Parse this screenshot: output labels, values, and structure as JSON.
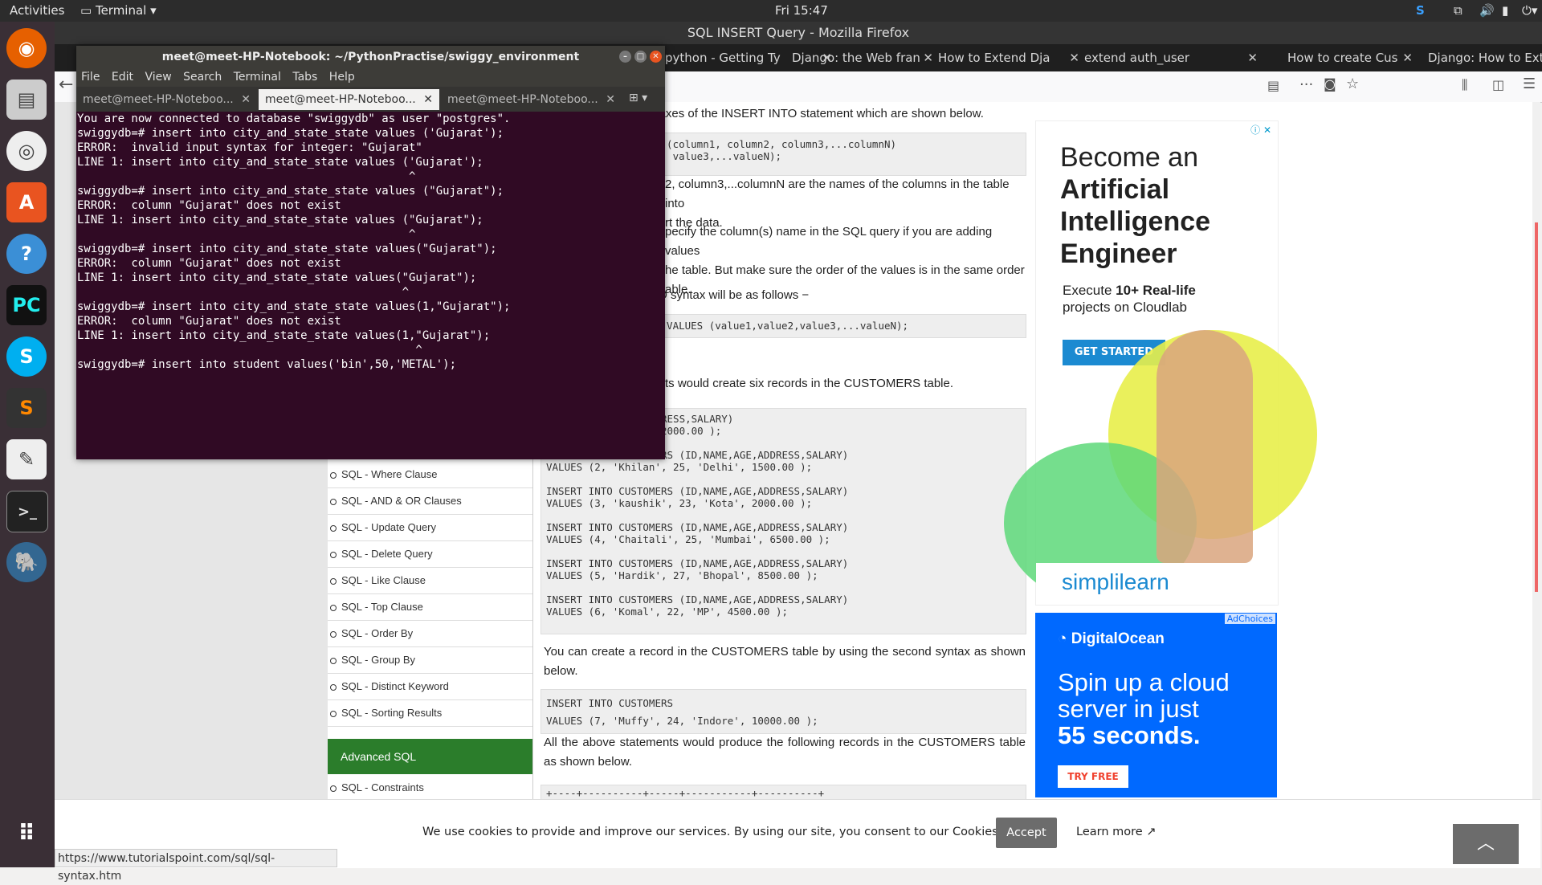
{
  "topbar": {
    "activities": "Activities",
    "app": "Terminal",
    "clock": "Fri 15:47"
  },
  "firefox": {
    "title": "SQL INSERT Query - Mozilla Firefox",
    "tabs": [
      "python - Getting Ty",
      "Django: the Web fran",
      "How to Extend Dja",
      "extend auth_user",
      "How to create Cus",
      "Django: How to Exten"
    ]
  },
  "page": {
    "p1": "ntaxes of the INSERT INTO statement which are shown below.",
    "code1": "E (column1, column2, column3,...columnN)\n2, value3,...valueN);",
    "p2a": "2, column3,...columnN are the names of the columns in the table into",
    "p2b": "rt the data.",
    "p3a": "pecify the column(s) name in the SQL query if you are adding values",
    "p3b": "he table. But make sure the order of the values is in the same order",
    "p3c": "able.",
    "p4": "D syntax will be as follows −",
    "code2": "E VALUES (value1,value2,value3,...valueN);",
    "p5": "ts would create six records in the CUSTOMERS table.",
    "code3": "RS (ID,NAME,AGE,ADDRESS,SALARY)\n, 32, 'Ahmedabad', 2000.00 );\n\nINSERT INTO CUSTOMERS (ID,NAME,AGE,ADDRESS,SALARY)\nVALUES (2, 'Khilan', 25, 'Delhi', 1500.00 );\n\nINSERT INTO CUSTOMERS (ID,NAME,AGE,ADDRESS,SALARY)\nVALUES (3, 'kaushik', 23, 'Kota', 2000.00 );\n\nINSERT INTO CUSTOMERS (ID,NAME,AGE,ADDRESS,SALARY)\nVALUES (4, 'Chaitali', 25, 'Mumbai', 6500.00 );\n\nINSERT INTO CUSTOMERS (ID,NAME,AGE,ADDRESS,SALARY)\nVALUES (5, 'Hardik', 27, 'Bhopal', 8500.00 );\n\nINSERT INTO CUSTOMERS (ID,NAME,AGE,ADDRESS,SALARY)\nVALUES (6, 'Komal', 22, 'MP', 4500.00 );",
    "p6": "You can create a record in the CUSTOMERS table by using the second syntax as shown below.",
    "code4": "INSERT INTO CUSTOMERS\nVALUES (7, 'Muffy', 24, 'Indore', 10000.00 );",
    "p7": "All the above statements would produce the following records in the CUSTOMERS table as shown below.",
    "code5": "+----+----------+-----+-----------+----------+"
  },
  "sidebar": {
    "items": [
      "SQL - Where Clause",
      "SQL - AND & OR Clauses",
      "SQL - Update Query",
      "SQL - Delete Query",
      "SQL - Like Clause",
      "SQL - Top Clause",
      "SQL - Order By",
      "SQL - Group By",
      "SQL - Distinct Keyword",
      "SQL - Sorting Results"
    ],
    "section": "Advanced SQL",
    "last": "SQL - Constraints"
  },
  "ad1": {
    "l1": "Become an",
    "l2": "Artificial",
    "l3": "Intelligence",
    "l4": "Engineer",
    "sub1": "Execute ",
    "sub_bold": "10+ Real-life",
    "sub2": "projects on Cloudlab",
    "cta": "GET STARTED",
    "brand": "simplilearn"
  },
  "ad2": {
    "brand": "DigitalOcean",
    "adchoices": "AdChoices",
    "l1": "Spin up a cloud",
    "l2": "server in just",
    "l3": "55 seconds.",
    "cta": "TRY FREE"
  },
  "cookie": {
    "text": "We use cookies to provide and improve our services. By using our site, you consent to our Cookies Policy.",
    "accept": "Accept",
    "learn": "Learn more"
  },
  "status": "https://www.tutorialspoint.com/sql/sql-syntax.htm",
  "terminal": {
    "title": "meet@meet-HP-Notebook: ~/PythonPractise/swiggy_environment",
    "menu": [
      "File",
      "Edit",
      "View",
      "Search",
      "Terminal",
      "Tabs",
      "Help"
    ],
    "tabs": [
      "meet@meet-HP-Noteboo...",
      "meet@meet-HP-Noteboo...",
      "meet@meet-HP-Noteboo..."
    ],
    "output": "You are now connected to database \"swiggydb\" as user \"postgres\".\nswiggydb=# insert into city_and_state_state values ('Gujarat');\nERROR:  invalid input syntax for integer: \"Gujarat\"\nLINE 1: insert into city_and_state_state values ('Gujarat');\n                                                 ^\nswiggydb=# insert into city_and_state_state values (\"Gujarat\");\nERROR:  column \"Gujarat\" does not exist\nLINE 1: insert into city_and_state_state values (\"Gujarat\");\n                                                 ^\nswiggydb=# insert into city_and_state_state values(\"Gujarat\");\nERROR:  column \"Gujarat\" does not exist\nLINE 1: insert into city_and_state_state values(\"Gujarat\");\n                                                ^\nswiggydb=# insert into city_and_state_state values(1,\"Gujarat\");\nERROR:  column \"Gujarat\" does not exist\nLINE 1: insert into city_and_state_state values(1,\"Gujarat\");\n                                                  ^\nswiggydb=# insert into student values('bin',50,'METAL');"
  }
}
